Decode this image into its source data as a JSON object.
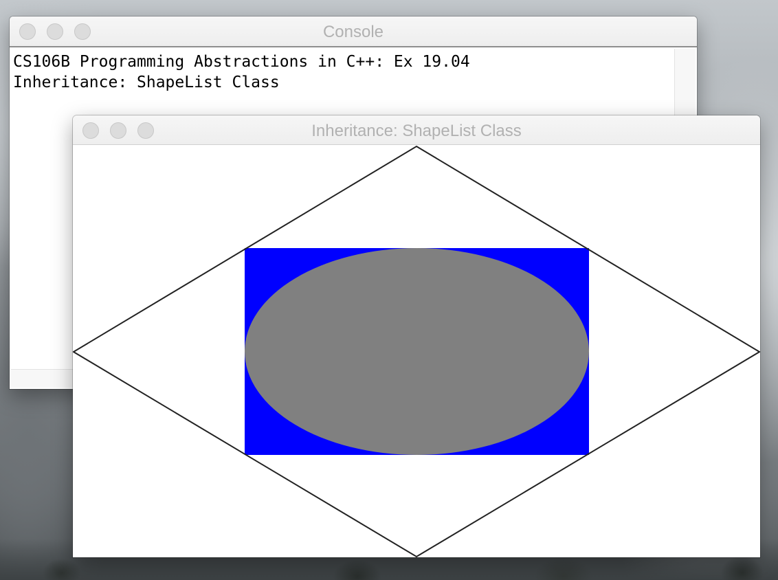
{
  "console_window": {
    "title": "Console",
    "lines": [
      "CS106B Programming Abstractions in C++: Ex 19.04",
      "Inheritance: ShapeList Class"
    ]
  },
  "graphics_window": {
    "title": "Inheritance: ShapeList Class",
    "shapes": [
      {
        "kind": "rectangle",
        "fill": "#0000ff"
      },
      {
        "kind": "oval",
        "fill": "#808080"
      },
      {
        "kind": "diamond",
        "stroke": "#222222",
        "fill": "none"
      }
    ]
  },
  "colors": {
    "rectangle_fill": "#0000ff",
    "oval_fill": "#808080",
    "diamond_stroke": "#222222",
    "title_text": "#b1b1b1"
  },
  "icons": {
    "close": "close-button-icon",
    "minimize": "minimize-button-icon",
    "zoom": "zoom-button-icon"
  }
}
